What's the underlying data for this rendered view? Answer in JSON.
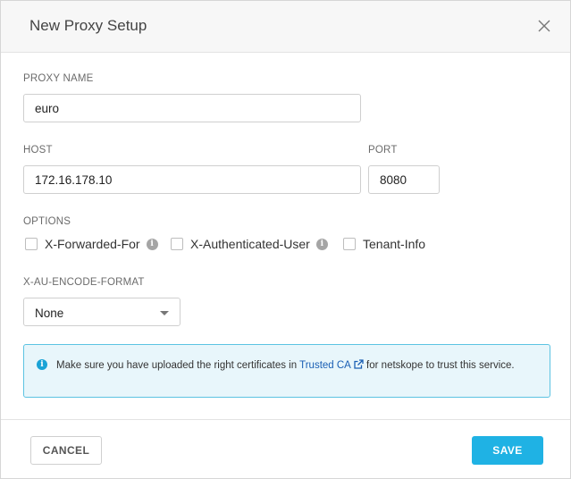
{
  "dialog": {
    "title": "New Proxy Setup",
    "close_icon": "close-icon"
  },
  "form": {
    "proxy_name_label": "PROXY NAME",
    "proxy_name_value": "euro",
    "host_label": "HOST",
    "host_value": "172.16.178.10",
    "port_label": "PORT",
    "port_value": "8080",
    "options_label": "OPTIONS",
    "options": [
      {
        "label": "X-Forwarded-For",
        "checked": false,
        "has_info": true
      },
      {
        "label": "X-Authenticated-User",
        "checked": false,
        "has_info": true
      },
      {
        "label": "Tenant-Info",
        "checked": false,
        "has_info": false
      }
    ],
    "encode_format_label": "X-AU-ENCODE-FORMAT",
    "encode_format_value": "None"
  },
  "alert": {
    "text_before": "Make sure you have uploaded the right certificates in ",
    "link_text": "Trusted CA",
    "text_after": " for netskope to trust this service.",
    "icon": "info-icon",
    "link_icon": "external-link-icon"
  },
  "footer": {
    "cancel_label": "CANCEL",
    "save_label": "SAVE"
  },
  "colors": {
    "primary": "#1fb2e4",
    "alert_bg": "#e8f6fb",
    "alert_border": "#5cc3e2",
    "link": "#1a5fb4"
  }
}
